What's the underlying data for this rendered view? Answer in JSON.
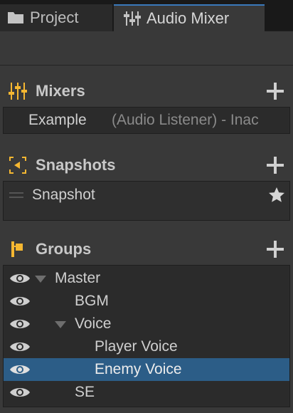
{
  "tabs": [
    {
      "label": "Project",
      "icon": "folder-icon",
      "active": false
    },
    {
      "label": "Audio Mixer",
      "icon": "mixer-sliders-icon",
      "active": true
    }
  ],
  "mixers": {
    "title": "Mixers",
    "items": [
      {
        "name": "Example",
        "note": "(Audio Listener) - Inac"
      }
    ]
  },
  "snapshots": {
    "title": "Snapshots",
    "items": [
      {
        "name": "Snapshot",
        "starred": true
      }
    ]
  },
  "groups": {
    "title": "Groups",
    "items": [
      {
        "name": "Master",
        "depth": 0,
        "expanded": true,
        "selected": false
      },
      {
        "name": "BGM",
        "depth": 1,
        "expanded": null,
        "selected": false
      },
      {
        "name": "Voice",
        "depth": 1,
        "expanded": true,
        "selected": false
      },
      {
        "name": "Player Voice",
        "depth": 2,
        "expanded": null,
        "selected": false
      },
      {
        "name": "Enemy Voice",
        "depth": 2,
        "expanded": null,
        "selected": true
      },
      {
        "name": "SE",
        "depth": 1,
        "expanded": null,
        "selected": false
      }
    ]
  },
  "colors": {
    "accent": "#f5b731",
    "selection": "#2c5d87",
    "tab_highlight": "#3a79bb"
  }
}
